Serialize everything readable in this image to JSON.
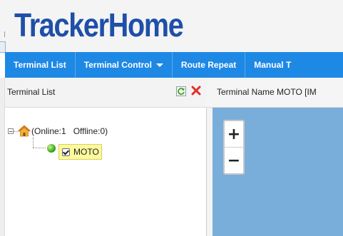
{
  "app": {
    "logo_text": "TrackerHome"
  },
  "navbar": {
    "items": [
      {
        "label": "Terminal List"
      },
      {
        "label": "Terminal Control",
        "has_dropdown": true
      },
      {
        "label": "Route Repeat"
      },
      {
        "label": "Manual T"
      }
    ]
  },
  "left_panel": {
    "title": "Terminal List",
    "refresh_icon": "refresh-icon",
    "close_icon": "close-icon",
    "tree": {
      "root_label": "(Online:1   Offline:0)",
      "nodes": [
        {
          "label": "MOTO",
          "status": "online",
          "checked": true
        }
      ]
    }
  },
  "right_panel": {
    "title": "Terminal Name MOTO [IM"
  },
  "map": {
    "zoom_in": "+",
    "zoom_out": "−"
  },
  "colors": {
    "brand": "#1f4fa8",
    "navbar": "#1e88e5",
    "highlight": "#fcfa9c",
    "online": "#3aa816",
    "map_bg": "#7aaeda"
  }
}
